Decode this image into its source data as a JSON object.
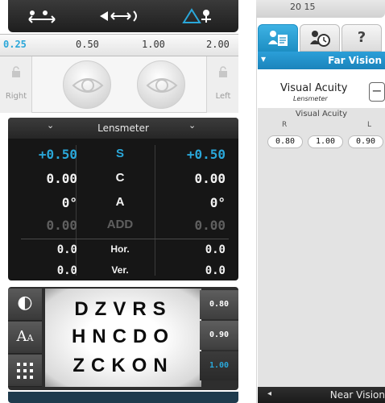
{
  "toolbar": {
    "tools": [
      "eyes-swap",
      "distance-toggle",
      "chart-warning"
    ]
  },
  "distance_scale": {
    "values": [
      "0.25",
      "0.50",
      "1.00",
      "2.00"
    ],
    "selected": "0.25"
  },
  "eyes": {
    "right_label": "Right",
    "left_label": "Left"
  },
  "lensmeter": {
    "title": "Lensmeter",
    "rows": [
      {
        "right": "+0.50",
        "label": "S",
        "left": "+0.50"
      },
      {
        "right": "0.00",
        "label": "C",
        "left": "0.00"
      },
      {
        "right": "0°",
        "label": "A",
        "left": "0°"
      },
      {
        "right": "0.00",
        "label": "ADD",
        "left": "0.00"
      },
      {
        "right": "0.0",
        "label": "Hor.",
        "left": "0.0"
      },
      {
        "right": "0.0",
        "label": "Ver.",
        "left": "0.0"
      }
    ]
  },
  "chart": {
    "lines": [
      "DZVRS",
      "HNCDO",
      "ZCKON"
    ],
    "acuities": [
      "0.80",
      "0.90",
      "1.00"
    ],
    "selected_acuity": "1.00",
    "tools": [
      "contrast",
      "font-size",
      "chart-grid"
    ]
  },
  "right_panel": {
    "top_peek": "20 15",
    "far_vision": "Far Vision",
    "near_vision": "Near Vision",
    "section_title": "Visual Acuity",
    "section_sub": "Lensmeter",
    "grid_title": "Visual Acuity",
    "col_r": "R",
    "col_l": "L",
    "values": [
      "0.80",
      "1.00",
      "0.90"
    ]
  },
  "colors": {
    "accent": "#2aa7d9"
  }
}
